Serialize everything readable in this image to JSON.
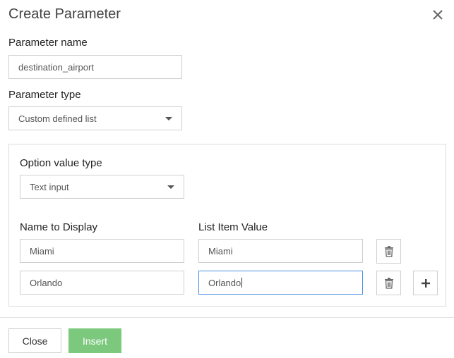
{
  "dialog": {
    "title": "Create Parameter"
  },
  "form": {
    "name_label": "Parameter name",
    "name_value": "destination_airport",
    "type_label": "Parameter type",
    "type_value": "Custom defined list"
  },
  "options": {
    "value_type_label": "Option value type",
    "value_type_value": "Text input",
    "col_display_header": "Name to Display",
    "col_value_header": "List Item Value",
    "rows": [
      {
        "display": "Miami",
        "value": "Miami"
      },
      {
        "display": "Orlando",
        "value": "Orlando"
      }
    ]
  },
  "footer": {
    "close_label": "Close",
    "insert_label": "Insert"
  },
  "colors": {
    "accent_green": "#7cc97e",
    "focus_blue": "#4a90e2"
  },
  "icons": {
    "close": "close-icon",
    "delete": "trash-icon",
    "add": "plus-icon",
    "dropdown": "caret-down-icon"
  }
}
